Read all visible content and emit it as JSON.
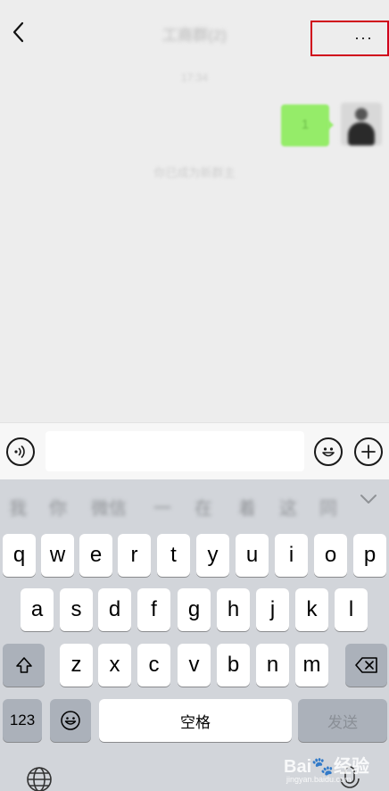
{
  "header": {
    "title": "工商群(2)",
    "more_label": "···"
  },
  "chat": {
    "time": "17:34",
    "message": "1",
    "system_notice": "你已成为新群主"
  },
  "input_bar": {
    "text_placeholder": ""
  },
  "keyboard": {
    "candidates": [
      "我",
      "你",
      "微信",
      "一",
      "在",
      "着",
      "这",
      "同"
    ],
    "row1": [
      "q",
      "w",
      "e",
      "r",
      "t",
      "y",
      "u",
      "i",
      "o",
      "p"
    ],
    "row2": [
      "a",
      "s",
      "d",
      "f",
      "g",
      "h",
      "j",
      "k",
      "l"
    ],
    "row3": [
      "z",
      "x",
      "c",
      "v",
      "b",
      "n",
      "m"
    ],
    "num_label": "123",
    "space_label": "空格",
    "send_label": "发送"
  },
  "watermark": {
    "brand": "Bai🐾经验",
    "sub": "jingyan.baidu.com"
  }
}
